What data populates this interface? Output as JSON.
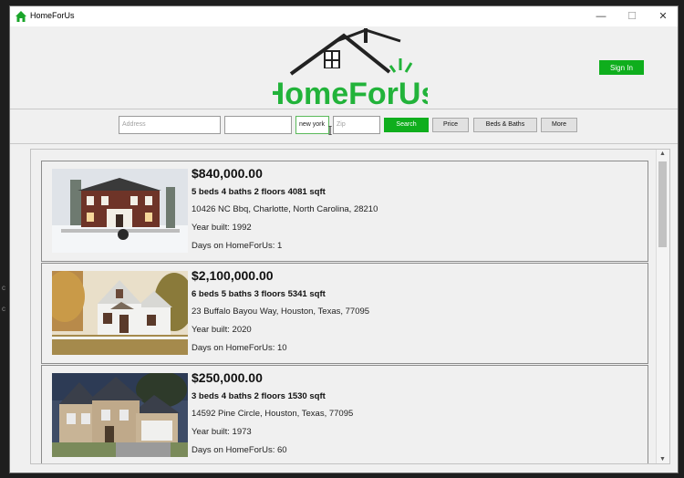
{
  "window": {
    "title": "HomeForUs"
  },
  "header": {
    "logo_text": "HomeForUs",
    "signin_label": "Sign In"
  },
  "search": {
    "address_placeholder": "Address",
    "field2_value": "",
    "city_value": "new york",
    "zip_placeholder": "Zip",
    "search_label": "Search",
    "price_label": "Price",
    "bedsbaths_label": "Beds & Baths",
    "more_label": "More"
  },
  "listings": [
    {
      "price": "$840,000.00",
      "specs": "5 beds 4 baths 2 floors 4081 sqft",
      "address": "10426 NC Bbq, Charlotte, North Carolina, 28210",
      "year": "Year built: 1992",
      "days": "Days on HomeForUs: 1",
      "photo": "house-photo-brick-snow"
    },
    {
      "price": "$2,100,000.00",
      "specs": "6 beds 5 baths 3 floors 5341 sqft",
      "address": "23 Buffalo Bayou Way, Houston, Texas, 77095",
      "year": "Year built: 2020",
      "days": "Days on HomeForUs: 10",
      "photo": "house-photo-white-cottage"
    },
    {
      "price": "$250,000.00",
      "specs": "3 beds 4 baths 2 floors 1530 sqft",
      "address": "14592 Pine Circle, Houston, Texas, 77095",
      "year": "Year built: 1973",
      "days": "Days on HomeForUs: 60",
      "photo": "house-photo-tan-suburban"
    }
  ],
  "colors": {
    "brand_green": "#0fae1d",
    "logo_green": "#22b33a"
  }
}
